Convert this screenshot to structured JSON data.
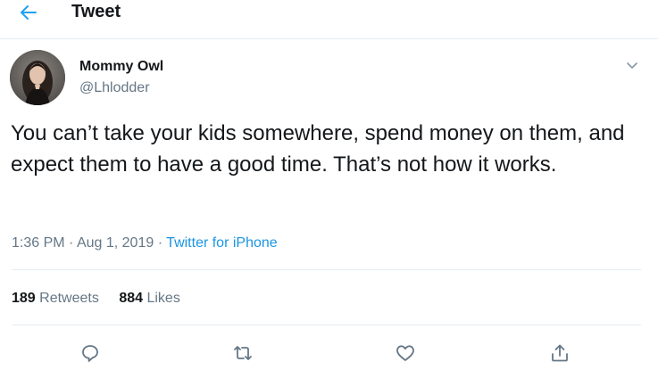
{
  "colors": {
    "accent": "#1da1f2",
    "link": "#1b95e0",
    "text": "#14171a",
    "secondary": "#657786",
    "border": "#e6ecf0"
  },
  "header": {
    "back_icon": "arrow-left-icon",
    "title": "Tweet"
  },
  "tweet": {
    "author": {
      "name": "Mommy Owl",
      "handle": "@Lhlodder"
    },
    "caret_icon": "chevron-down-icon",
    "text": "You can’t take your kids somewhere, spend money on them, and expect them to have a good time. That’s not how it works.",
    "time": "1:36 PM",
    "separator": "·",
    "date": "Aug 1, 2019",
    "source": "Twitter for iPhone",
    "stats": {
      "retweets_count": "189",
      "retweets_label": "Retweets",
      "likes_count": "884",
      "likes_label": "Likes"
    },
    "actions": {
      "reply_icon": "reply-icon",
      "retweet_icon": "retweet-icon",
      "like_icon": "heart-icon",
      "share_icon": "share-icon"
    }
  }
}
